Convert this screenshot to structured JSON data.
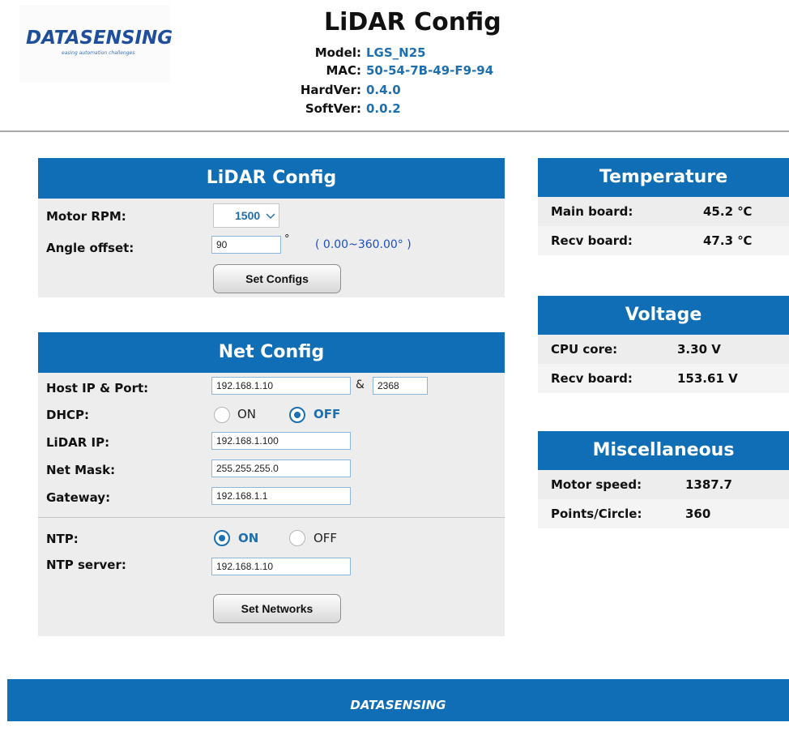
{
  "header": {
    "logo_text": "DATASENSING",
    "logo_tagline": "easing automation challenges",
    "title": "LiDAR Config",
    "info": [
      {
        "label": "Model:",
        "value": "LGS_N25"
      },
      {
        "label": "MAC:",
        "value": "50-54-7B-49-F9-94"
      },
      {
        "label": "HardVer:",
        "value": "0.4.0"
      },
      {
        "label": "SoftVer:",
        "value": "0.0.2"
      }
    ]
  },
  "lidar_config": {
    "title": "LiDAR Config",
    "motor_rpm_label": "Motor RPM:",
    "motor_rpm_value": "1500",
    "angle_offset_label": "Angle offset:",
    "angle_offset_value": "90",
    "degree_symbol": "°",
    "angle_range_hint": "( 0.00~360.00° )",
    "set_button": "Set Configs"
  },
  "net_config": {
    "title": "Net Config",
    "host_label": "Host IP & Port:",
    "host_ip": "192.168.1.10",
    "host_sep": "&",
    "host_port": "2368",
    "dhcp_label": "DHCP:",
    "dhcp_on": "ON",
    "dhcp_off": "OFF",
    "dhcp_selected": "OFF",
    "lidar_ip_label": "LiDAR IP:",
    "lidar_ip": "192.168.1.100",
    "mask_label": "Net Mask:",
    "mask": "255.255.255.0",
    "gateway_label": "Gateway:",
    "gateway": "192.168.1.1",
    "ntp_label": "NTP:",
    "ntp_on": "ON",
    "ntp_off": "OFF",
    "ntp_selected": "ON",
    "ntp_server_label": "NTP server:",
    "ntp_server": "192.168.1.10",
    "set_button": "Set Networks"
  },
  "temperature": {
    "title": "Temperature",
    "rows": [
      {
        "label": "Main board:",
        "value": "45.2 ℃"
      },
      {
        "label": "Recv board:",
        "value": "47.3 ℃"
      }
    ]
  },
  "voltage": {
    "title": "Voltage",
    "rows": [
      {
        "label": "CPU core:",
        "value": "3.30 V"
      },
      {
        "label": "Recv board:",
        "value": "153.61 V"
      }
    ]
  },
  "misc": {
    "title": "Miscellaneous",
    "rows": [
      {
        "label": "Motor speed:",
        "value": "1387.7"
      },
      {
        "label": "Points/Circle:",
        "value": "360"
      }
    ]
  },
  "footer": {
    "text": "DATASENSING"
  },
  "colors": {
    "accent": "#0f6eb5",
    "value_blue": "#1d6fb0",
    "panel_bg": "#ededed"
  }
}
